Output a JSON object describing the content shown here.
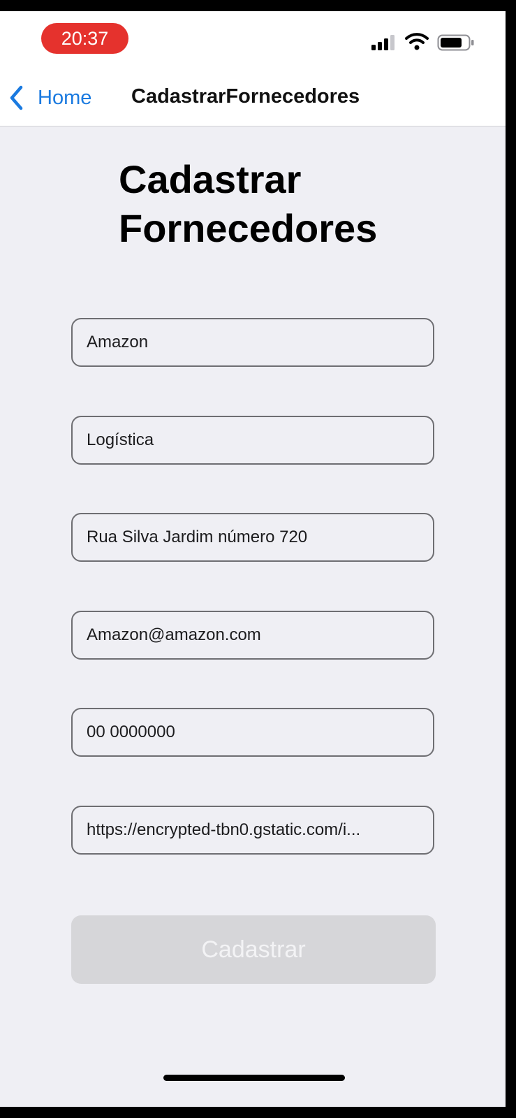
{
  "status_bar": {
    "time": "20:37",
    "signal_icon": "cellular-signal-icon",
    "wifi_icon": "wifi-icon",
    "battery_icon": "battery-icon"
  },
  "nav": {
    "back_label": "Home",
    "back_icon": "chevron-left-icon",
    "title": "CadastrarFornecedores",
    "accent_color": "#1a7ae0"
  },
  "page": {
    "title_line1": "Cadastrar",
    "title_line2": "Fornecedores"
  },
  "form": {
    "fields": [
      {
        "value": "Amazon"
      },
      {
        "value": "Logística"
      },
      {
        "value": "Rua Silva Jardim número 720"
      },
      {
        "value": "Amazon@amazon.com"
      },
      {
        "value": "00 0000000"
      },
      {
        "value": "https://encrypted-tbn0.gstatic.com/i..."
      }
    ],
    "submit_label": "Cadastrar"
  },
  "colors": {
    "status_time_pill": "#e5322d",
    "background": "#efeff4",
    "button_disabled": "#d6d6d9"
  }
}
